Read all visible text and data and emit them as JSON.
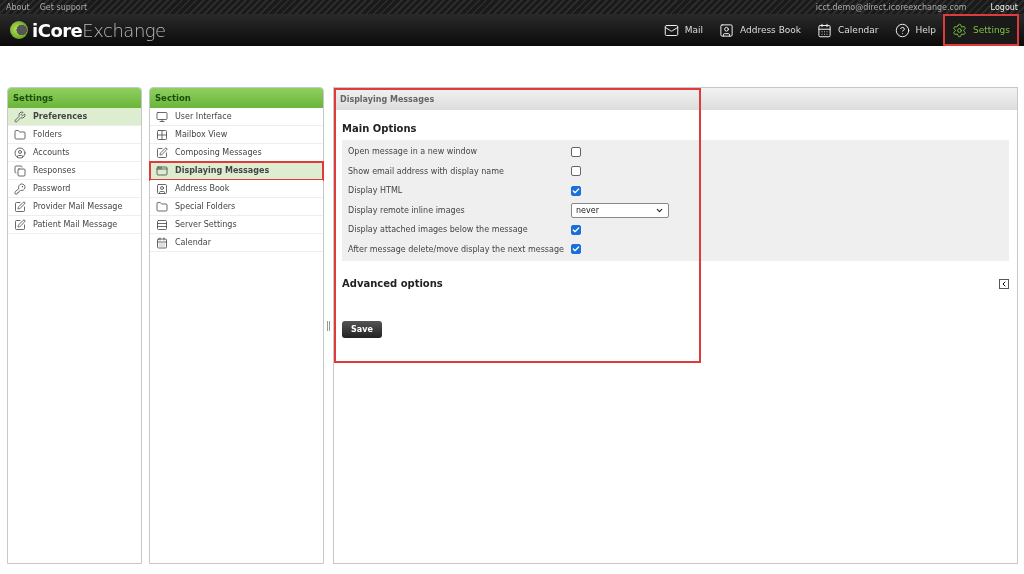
{
  "top_links": [
    "About",
    "Get support"
  ],
  "user_email": "icct.demo@direct.icoreexchange.com",
  "logout": "Logout",
  "logo": {
    "bold": "iCore",
    "light": "Exchange"
  },
  "nav": [
    {
      "label": "Mail",
      "selected": false,
      "highlighted": false
    },
    {
      "label": "Address Book",
      "selected": false,
      "highlighted": false
    },
    {
      "label": "Calendar",
      "selected": false,
      "highlighted": false
    },
    {
      "label": "Help",
      "selected": false,
      "highlighted": false
    },
    {
      "label": "Settings",
      "selected": true,
      "highlighted": true
    }
  ],
  "settings_panel": {
    "title": "Settings",
    "items": [
      {
        "label": "Preferences",
        "selected": true
      },
      {
        "label": "Folders",
        "selected": false
      },
      {
        "label": "Accounts",
        "selected": false
      },
      {
        "label": "Responses",
        "selected": false
      },
      {
        "label": "Password",
        "selected": false
      },
      {
        "label": "Provider Mail Message",
        "selected": false
      },
      {
        "label": "Patient Mail Message",
        "selected": false
      }
    ]
  },
  "section_panel": {
    "title": "Section",
    "items": [
      {
        "label": "User Interface",
        "selected": false,
        "highlighted": false
      },
      {
        "label": "Mailbox View",
        "selected": false,
        "highlighted": false
      },
      {
        "label": "Composing Messages",
        "selected": false,
        "highlighted": false
      },
      {
        "label": "Displaying Messages",
        "selected": true,
        "highlighted": true
      },
      {
        "label": "Address Book",
        "selected": false,
        "highlighted": false
      },
      {
        "label": "Special Folders",
        "selected": false,
        "highlighted": false
      },
      {
        "label": "Server Settings",
        "selected": false,
        "highlighted": false
      },
      {
        "label": "Calendar",
        "selected": false,
        "highlighted": false
      }
    ]
  },
  "content": {
    "title": "Displaying Messages",
    "highlighted": true,
    "main_heading": "Main Options",
    "options": [
      {
        "kind": "checkbox",
        "label": "Open message in a new window",
        "checked": false
      },
      {
        "kind": "checkbox",
        "label": "Show email address with display name",
        "checked": false
      },
      {
        "kind": "checkbox",
        "label": "Display HTML",
        "checked": true
      },
      {
        "kind": "select",
        "label": "Display remote inline images",
        "value": "never"
      },
      {
        "kind": "checkbox",
        "label": "Display attached images below the message",
        "checked": true
      },
      {
        "kind": "checkbox",
        "label": "After message delete/move display the next message",
        "checked": true
      }
    ],
    "advanced_heading": "Advanced options",
    "advanced_expanded": false,
    "save": "Save"
  }
}
